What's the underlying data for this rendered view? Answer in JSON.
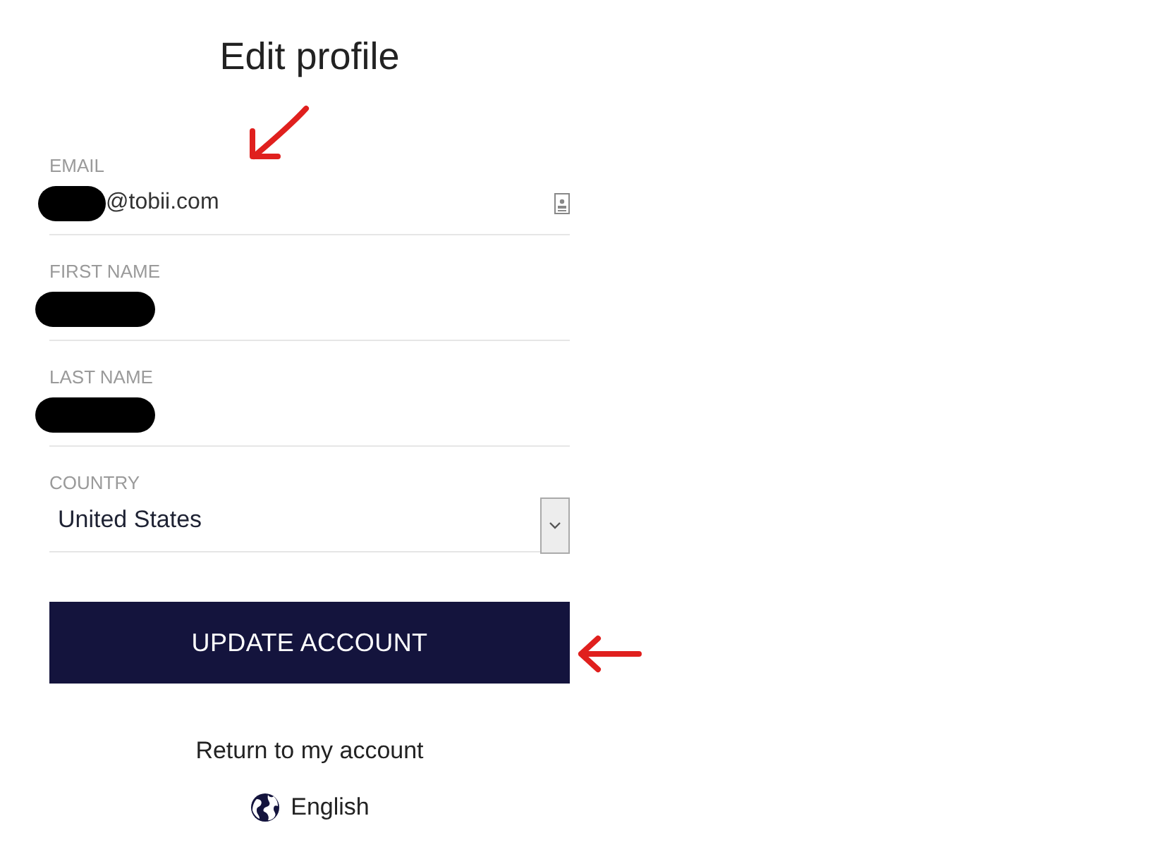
{
  "title": "Edit profile",
  "fields": [
    {
      "kind": "email",
      "label": "EMAIL",
      "value": "@tobii.com",
      "redacted": true,
      "annotated": true
    },
    {
      "kind": "text",
      "label": "FIRST NAME",
      "redacted": true,
      "annotated": false
    },
    {
      "kind": "text",
      "label": "LAST NAME",
      "redacted": true,
      "annotated": false
    },
    {
      "kind": "select",
      "label": "COUNTRY",
      "value": "United States",
      "redacted": false,
      "annotated": false
    }
  ],
  "submit": {
    "label": "UPDATE ACCOUNT",
    "annotated": true
  },
  "return_link": "Return to my account",
  "language": "English"
}
